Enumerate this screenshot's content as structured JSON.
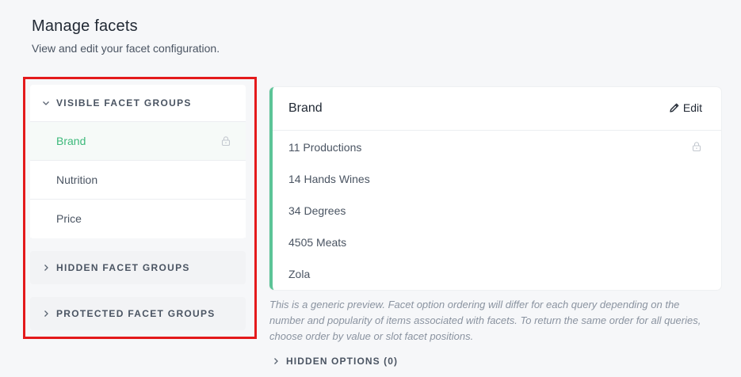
{
  "header": {
    "title": "Manage facets",
    "subtitle": "View and edit your facet configuration."
  },
  "sidebar": {
    "groups": [
      {
        "label": "VISIBLE FACET GROUPS",
        "expanded": true,
        "items": [
          {
            "label": "Brand",
            "active": true,
            "locked": true
          },
          {
            "label": "Nutrition",
            "active": false,
            "locked": false
          },
          {
            "label": "Price",
            "active": false,
            "locked": false
          }
        ]
      },
      {
        "label": "HIDDEN FACET GROUPS",
        "expanded": false
      },
      {
        "label": "PROTECTED FACET GROUPS",
        "expanded": false
      }
    ]
  },
  "detail": {
    "title": "Brand",
    "edit_label": "Edit",
    "options": [
      "11 Productions",
      "14 Hands Wines",
      "34 Degrees",
      "4505 Meats",
      "Zola"
    ],
    "note": "This is a generic preview. Facet option ordering will differ for each query depending on the number and popularity of items associated with facets. To return the same order for all queries, choose order by value or slot facet positions.",
    "hidden_options_label": "HIDDEN OPTIONS (0)"
  },
  "colors": {
    "accent": "#3db97b",
    "card_border": "#5cc497",
    "highlight_frame": "#e41a1c"
  },
  "icons": {
    "chevron_expanded": "chevron-down-icon",
    "chevron_collapsed": "chevron-right-icon",
    "lock": "lock-icon",
    "edit": "pencil-icon"
  }
}
